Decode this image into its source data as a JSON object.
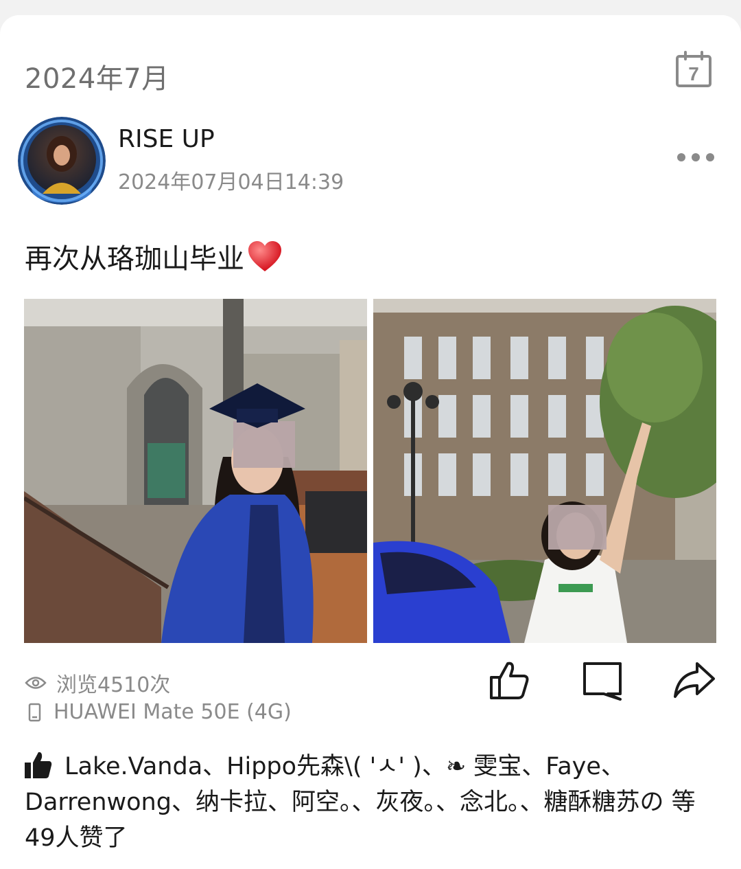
{
  "header": {
    "month_label": "2024年7月",
    "calendar_day": "7"
  },
  "post": {
    "username": "RISE UP",
    "timestamp": "2024年07月04日14:39",
    "text": "再次从珞珈山毕业",
    "views": "浏览4510次",
    "device": "HUAWEI Mate 50E (4G)",
    "likes_text": "Lake.Vanda、Hippo先森\\( 'ㅅ' )、❧ 雯宝、Faye、Darrenwong、纳卡拉、阿空。、灰夜。、念北。、糖酥糖苏の 等49人赞了"
  },
  "icons": {
    "calendar": "calendar-icon",
    "more": "more-icon",
    "heart": "heart-icon",
    "eye": "eye-icon",
    "phone": "phone-icon",
    "like": "thumbs-up-icon",
    "comment": "comment-icon",
    "share": "share-icon",
    "likes_thumb": "thumbs-up-filled-icon"
  },
  "colors": {
    "background": "#f2f2f2",
    "card": "#ffffff",
    "primary_text": "#1a1a1a",
    "secondary_text": "#8a8a8a",
    "heart": "#e8202a"
  }
}
